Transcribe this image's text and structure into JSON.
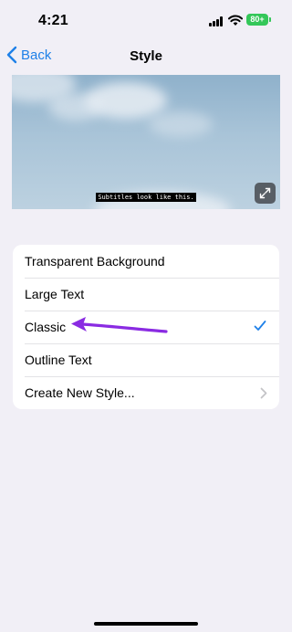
{
  "status_bar": {
    "time": "4:21",
    "battery": "80+"
  },
  "nav": {
    "back_label": "Back",
    "title": "Style"
  },
  "preview": {
    "caption": "Subtitles look like this."
  },
  "styles": [
    {
      "label": "Transparent Background",
      "selected": false
    },
    {
      "label": "Large Text",
      "selected": false
    },
    {
      "label": "Classic",
      "selected": true
    },
    {
      "label": "Outline Text",
      "selected": false
    },
    {
      "label": "Create New Style...",
      "has_chevron": true
    }
  ],
  "colors": {
    "accent": "#1e80e8",
    "annotation_arrow": "#8a2be2",
    "battery": "#34c759"
  }
}
